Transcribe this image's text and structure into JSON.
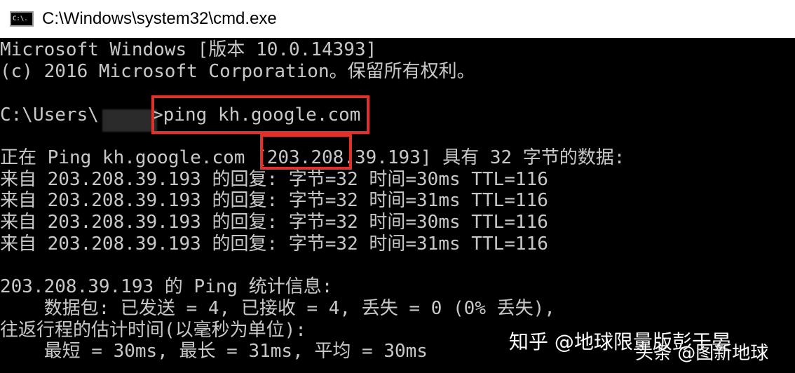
{
  "window": {
    "title": "C:\\Windows\\system32\\cmd.exe",
    "icon_text": "C:\\."
  },
  "console": {
    "lines": [
      "Microsoft Windows [版本 10.0.14393]",
      "(c) 2016 Microsoft Corporation。保留所有权利。",
      "",
      "C:\\Users\\",
      "",
      "正在 Ping kh.google.com [203.208.39.193] 具有 32 字节的数据:",
      "来自 203.208.39.193 的回复: 字节=32 时间=30ms TTL=116",
      "来自 203.208.39.193 的回复: 字节=32 时间=31ms TTL=116",
      "来自 203.208.39.193 的回复: 字节=32 时间=30ms TTL=116",
      "来自 203.208.39.193 的回复: 字节=32 时间=31ms TTL=116",
      "",
      "203.208.39.193 的 Ping 统计信息:",
      "    数据包: 已发送 = 4, 已接收 = 4, 丢失 = 0 (0% 丢失),",
      "往返行程的估计时间(以毫秒为单位):",
      "    最短 = 30ms, 最长 = 31ms, 平均 = 30ms"
    ],
    "command": ">ping kh.google.com"
  },
  "watermarks": {
    "zhihu": "知乎 @地球限量版彭于晏",
    "toutiao": "头条 @图新地球"
  },
  "colors": {
    "highlight": "#e0312b",
    "console_text": "#c8c8c8",
    "console_bg": "#000000"
  }
}
